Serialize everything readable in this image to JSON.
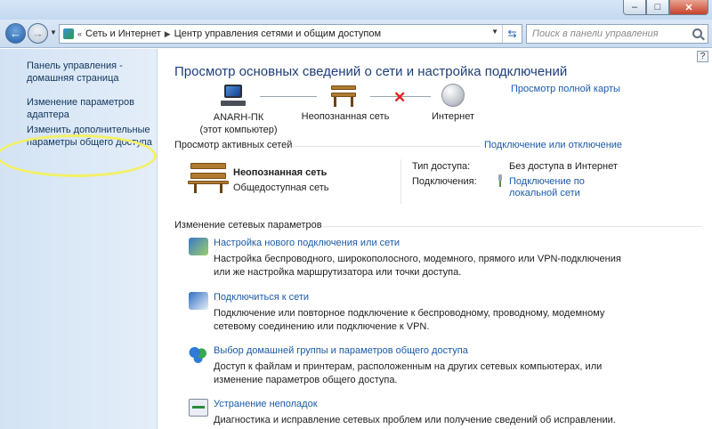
{
  "address_bar": {
    "crumbs": [
      "Сеть и Интернет",
      "Центр управления сетями и общим доступом"
    ],
    "search_placeholder": "Поиск в панели управления"
  },
  "sidebar": {
    "items": [
      {
        "label": "Панель управления - домашняя страница"
      },
      {
        "label": "Изменение параметров адаптера"
      },
      {
        "label": "Изменить дополнительные параметры общего доступа"
      }
    ]
  },
  "main": {
    "help": "?",
    "title": "Просмотр основных сведений о сети и настройка подключений",
    "full_map_link": "Просмотр полной карты",
    "map": {
      "computer_name": "ANARH-ПК",
      "computer_sub": "(этот компьютер)",
      "network": "Неопознанная сеть",
      "internet": "Интернет"
    },
    "active_networks": {
      "header": "Просмотр активных сетей",
      "connect_link": "Подключение или отключение",
      "network_name": "Неопознанная сеть",
      "network_type": "Общедоступная сеть",
      "access_type_label": "Тип доступа:",
      "access_type_value": "Без доступа в Интернет",
      "connections_label": "Подключения:",
      "connections_value": "Подключение по локальной сети"
    },
    "settings": {
      "header": "Изменение сетевых параметров",
      "tasks": [
        {
          "title": "Настройка нового подключения или сети",
          "desc": "Настройка беспроводного, широкополосного, модемного, прямого или VPN-подключения или же настройка маршрутизатора или точки доступа."
        },
        {
          "title": "Подключиться к сети",
          "desc": "Подключение или повторное подключение к беспроводному, проводному, модемному сетевому соединению или подключение к VPN."
        },
        {
          "title": "Выбор домашней группы и параметров общего доступа",
          "desc": "Доступ к файлам и принтерам, расположенным на других сетевых компьютерах, или изменение параметров общего доступа."
        },
        {
          "title": "Устранение неполадок",
          "desc": "Диагностика и исправление сетевых проблем или получение сведений об исправлении."
        }
      ]
    }
  }
}
